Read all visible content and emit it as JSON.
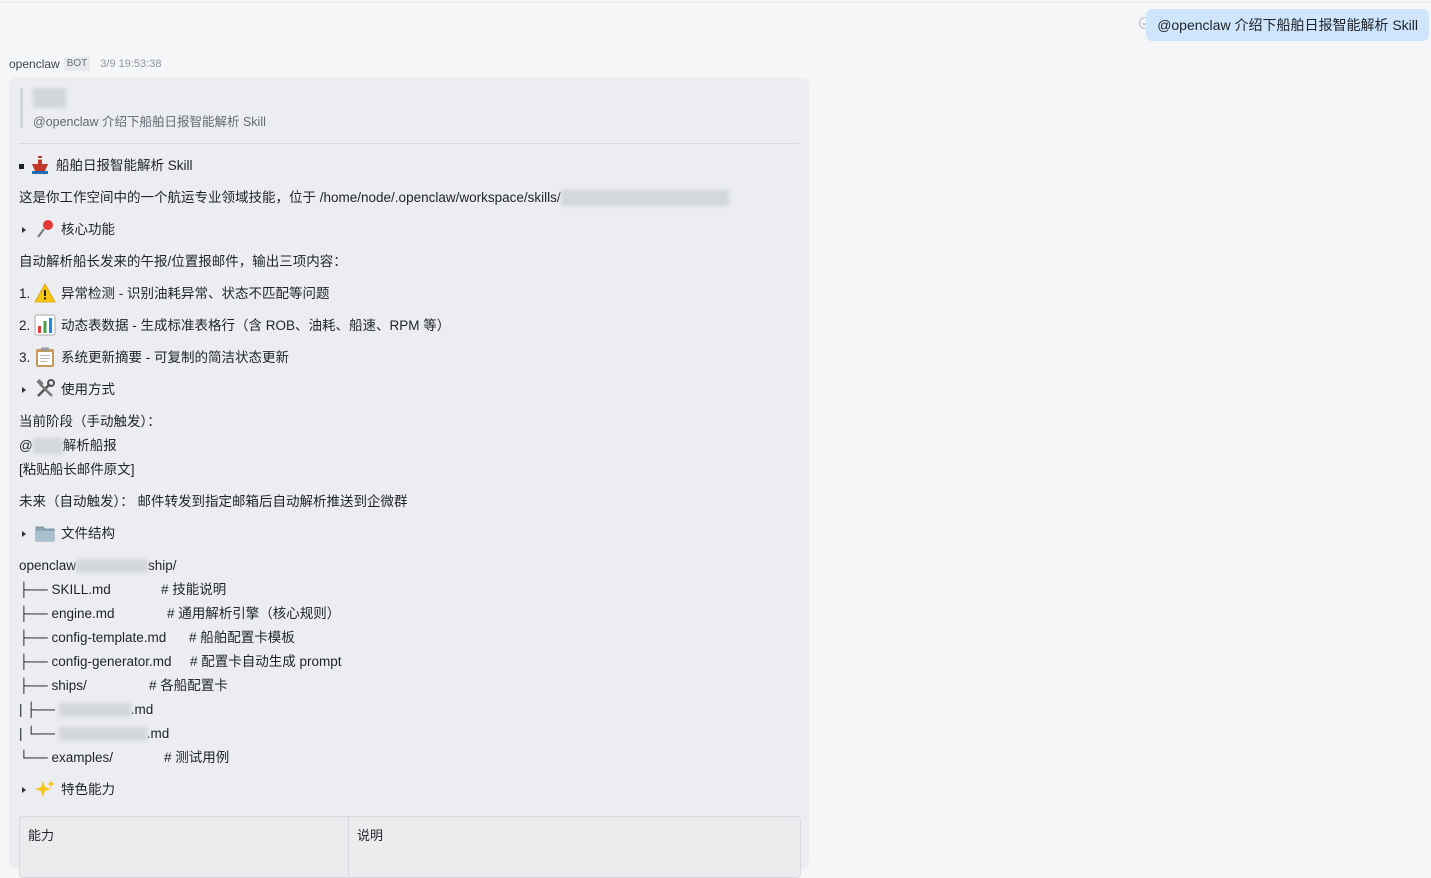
{
  "user_message": "@openclaw 介绍下船舶日报智能解析 Skill",
  "bot": {
    "name": "openclaw",
    "badge": "BOT",
    "time": "3/9 19:53:38"
  },
  "quote": {
    "text": "@openclaw  介绍下船舶日报智能解析 Skill"
  },
  "content": {
    "title": "船舶日报智能解析 Skill",
    "intro": "这是你工作空间中的一个航运专业领域技能，位于 /home/node/.openclaw/workspace/skills/",
    "sec_core": "核心功能",
    "core_desc": "自动解析船长发来的午报/位置报邮件，输出三项内容：",
    "items": [
      {
        "num": "1.",
        "text": "异常检测 - 识别油耗异常、状态不匹配等问题"
      },
      {
        "num": "2.",
        "text": "动态表数据 - 生成标准表格行（含 ROB、油耗、船速、RPM 等）"
      },
      {
        "num": "3.",
        "text": "系统更新摘要 - 可复制的简洁状态更新"
      }
    ],
    "sec_usage": "使用方式",
    "usage_stage": "当前阶段（手动触发）：",
    "usage_at": "@",
    "usage_cmd": "解析船报",
    "usage_paste": "[粘贴船长邮件原文]",
    "usage_future": "未来（自动触发）： 邮件转发到指定邮箱后自动解析推送到企微群",
    "sec_files": "文件结构",
    "tree_root_a": "openclaw",
    "tree_root_b": "ship/",
    "tree": [
      {
        "prefix": "├── ",
        "name": "SKILL.md",
        "comment": "# 技能说明"
      },
      {
        "prefix": "├── ",
        "name": "engine.md",
        "comment": "# 通用解析引擎（核心规则）"
      },
      {
        "prefix": "├── ",
        "name": "config-template.md",
        "comment": "# 船舶配置卡模板"
      },
      {
        "prefix": "├── ",
        "name": "config-generator.md",
        "comment": "# 配置卡自动生成 prompt"
      },
      {
        "prefix": "├── ",
        "name": "ships/",
        "comment": "# 各船配置卡"
      },
      {
        "prefix": "|    ├── ",
        "name": ".md",
        "comment": ""
      },
      {
        "prefix": "|    └── ",
        "name": ".md",
        "comment": ""
      },
      {
        "prefix": "└── ",
        "name": "examples/",
        "comment": "# 测试用例"
      }
    ],
    "sec_features": "特色能力",
    "table_headers": [
      "能力",
      "说明"
    ]
  }
}
